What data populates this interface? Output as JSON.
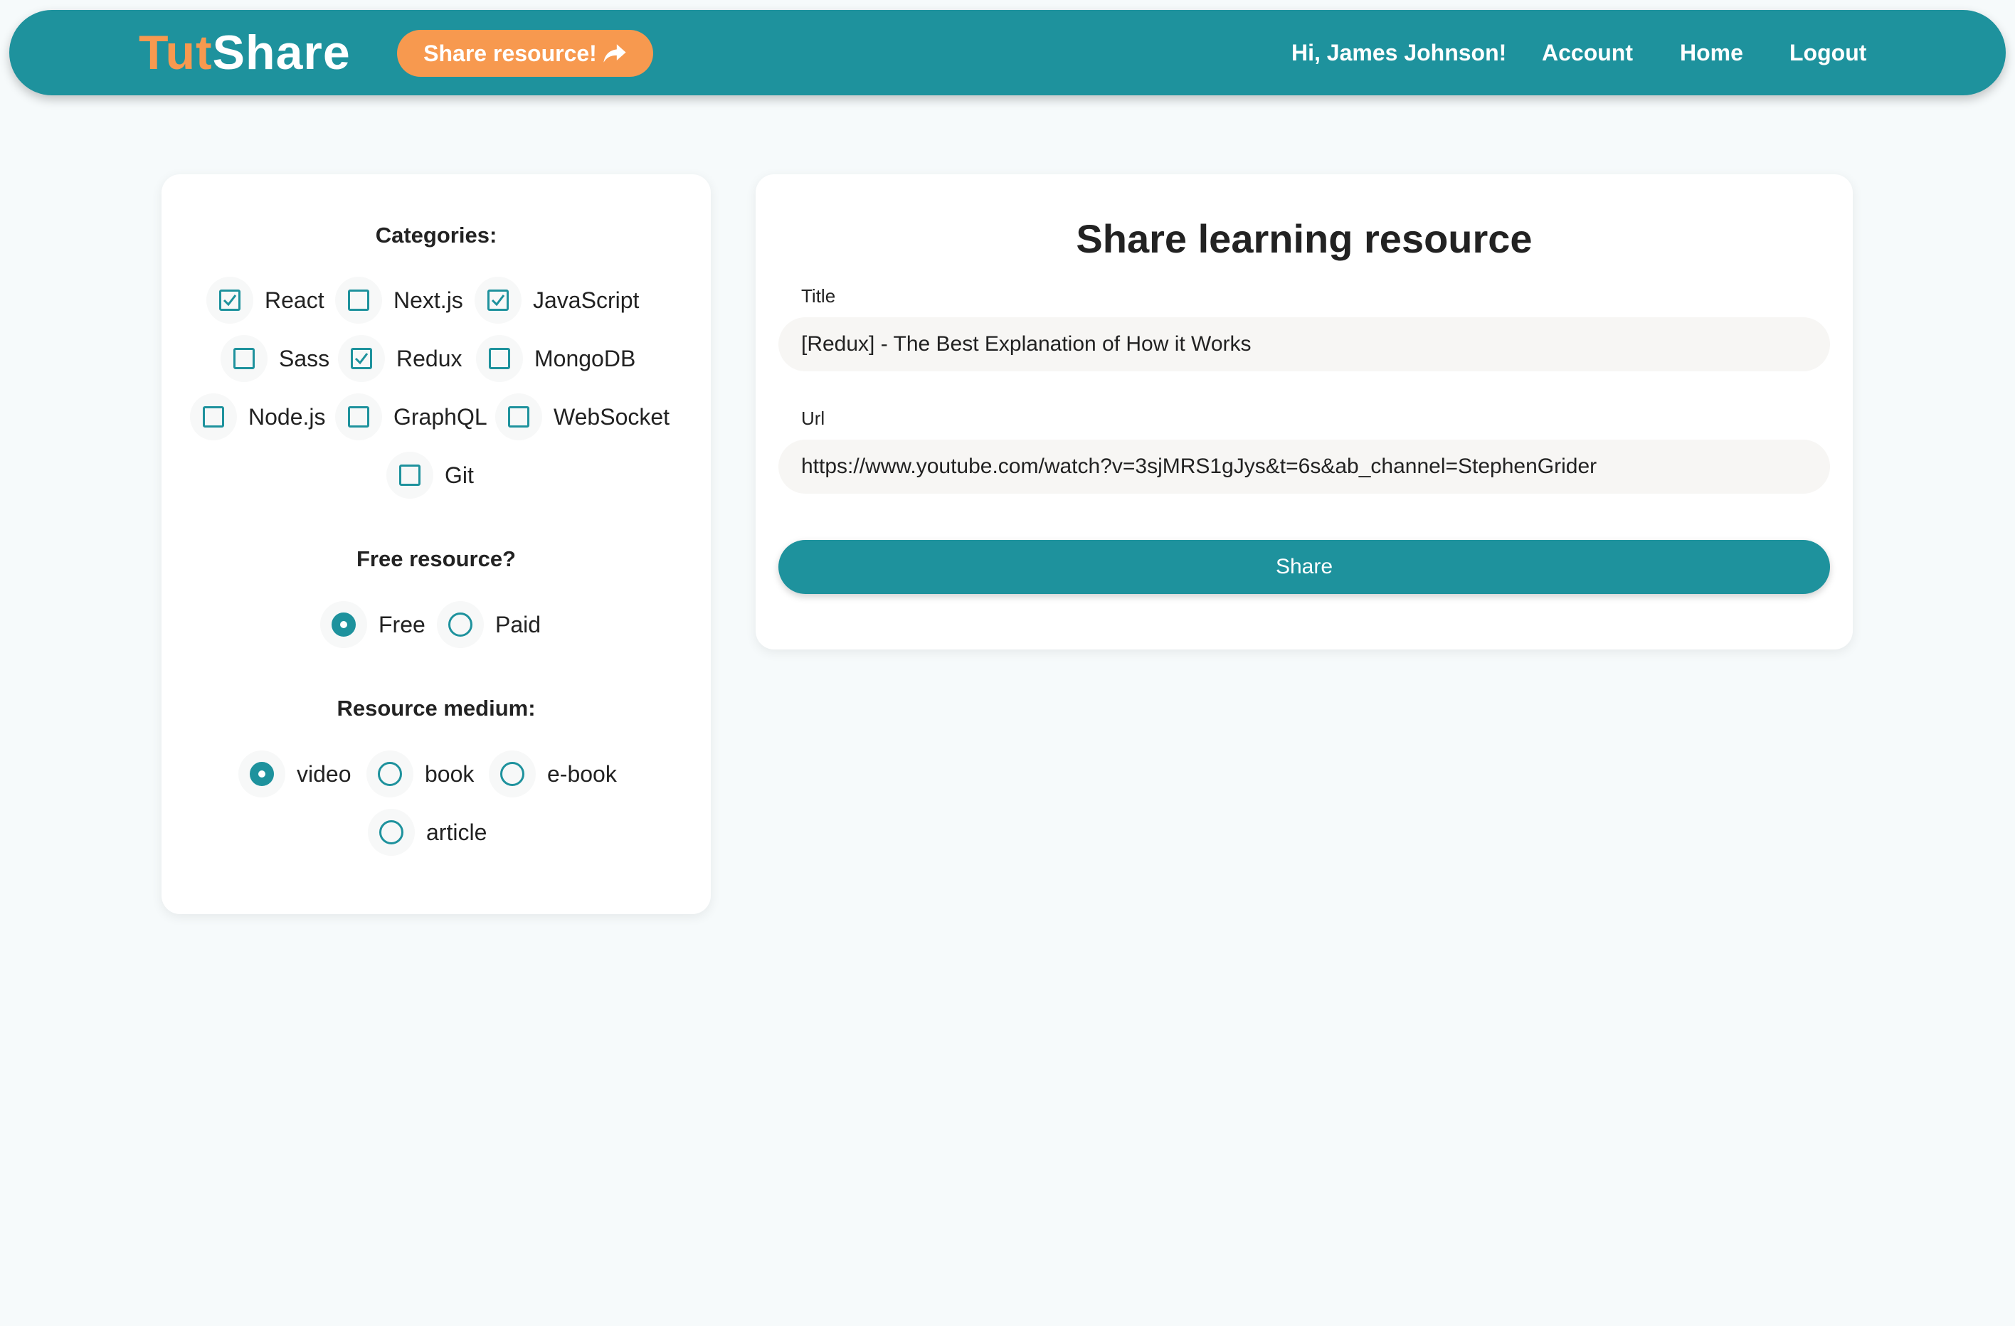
{
  "navbar": {
    "logo_part1": "Tut",
    "logo_part2": "Share",
    "share_resource_label": "Share resource!",
    "greeting": "Hi, James Johnson!",
    "account_label": "Account",
    "home_label": "Home",
    "logout_label": "Logout"
  },
  "filters": {
    "categories_title": "Categories:",
    "categories": [
      {
        "label": "React",
        "checked": true
      },
      {
        "label": "Next.js",
        "checked": false
      },
      {
        "label": "JavaScript",
        "checked": true
      },
      {
        "label": "Sass",
        "checked": false
      },
      {
        "label": "Redux",
        "checked": true
      },
      {
        "label": "MongoDB",
        "checked": false
      },
      {
        "label": "Node.js",
        "checked": false
      },
      {
        "label": "GraphQL",
        "checked": false
      },
      {
        "label": "WebSocket",
        "checked": false
      },
      {
        "label": "Git",
        "checked": false
      }
    ],
    "free_title": "Free resource?",
    "free_options": [
      {
        "label": "Free",
        "selected": true
      },
      {
        "label": "Paid",
        "selected": false
      }
    ],
    "medium_title": "Resource medium:",
    "medium_options": [
      {
        "label": "video",
        "selected": true
      },
      {
        "label": "book",
        "selected": false
      },
      {
        "label": "e-book",
        "selected": false
      },
      {
        "label": "article",
        "selected": false
      }
    ]
  },
  "share_form": {
    "heading": "Share learning resource",
    "title_label": "Title",
    "title_value": "[Redux] - The Best Explanation of How it Works",
    "url_label": "Url",
    "url_value": "https://www.youtube.com/watch?v=3sjMRS1gJys&t=6s&ab_channel=StephenGrider",
    "submit_label": "Share"
  },
  "colors": {
    "primary": "#1e929d",
    "accent": "#f7994f",
    "background": "#f6fafb"
  }
}
